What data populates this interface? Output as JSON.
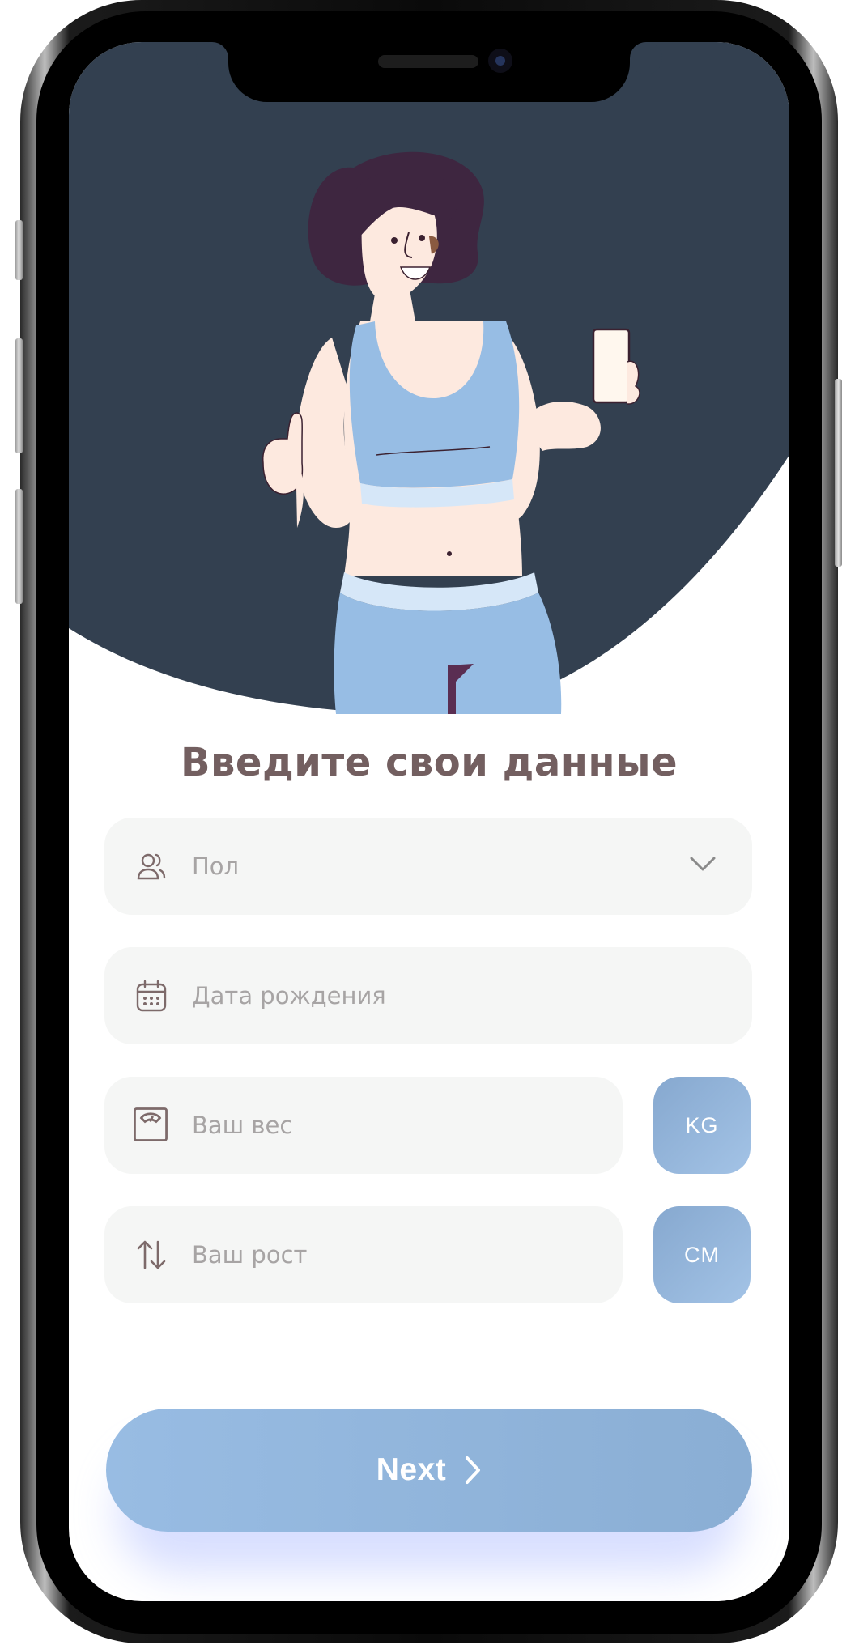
{
  "form": {
    "title": "Введите свои данные",
    "gender": {
      "placeholder": "Пол",
      "icon": "users-icon"
    },
    "birthdate": {
      "placeholder": "Дата рождения",
      "icon": "calendar-icon"
    },
    "weight": {
      "placeholder": "Ваш вес",
      "icon": "scale-icon",
      "unit": "KG"
    },
    "height": {
      "placeholder": "Ваш рост",
      "icon": "arrows-up-down-icon",
      "unit": "CM"
    }
  },
  "actions": {
    "next_label": "Next"
  },
  "colors": {
    "hero_background": "#334050",
    "accent": "#8fb3d9",
    "field_background": "#f5f6f5",
    "title": "#735f60",
    "placeholder": "#a7a4a4"
  }
}
